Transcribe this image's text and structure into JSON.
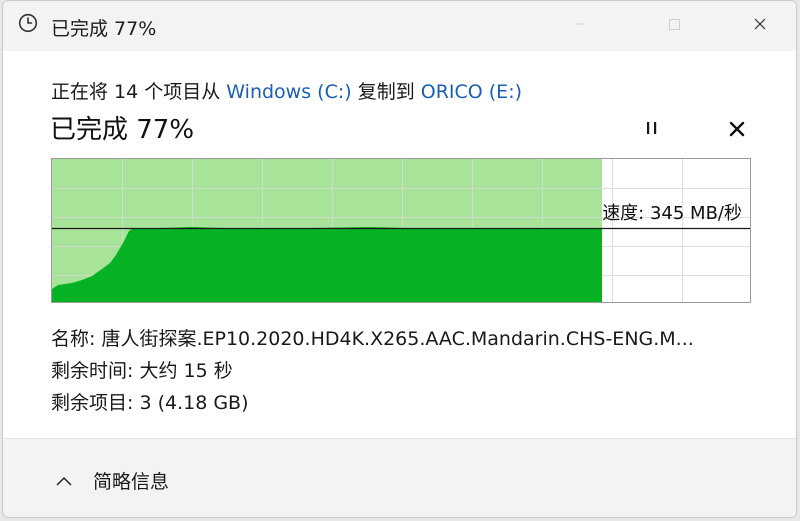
{
  "window": {
    "title": "已完成 77%"
  },
  "header": {
    "prefix": "正在将 14 个项目从 ",
    "source": "Windows (C:)",
    "middle": " 复制到 ",
    "destination": "ORICO (E:)"
  },
  "status": {
    "text": "已完成 77%",
    "progress_percent": 77
  },
  "graph": {
    "speed_label": "速度: 345 MB/秒",
    "colors": {
      "done_light": "#a8e39a",
      "done_dark": "#06b223",
      "grid": "#d9d9d9",
      "line": "#1a1a1a"
    }
  },
  "details": {
    "name_label": "名称:",
    "name_value": "唐人街探案.EP10.2020.HD4K.X265.AAC.Mandarin.CHS-ENG.M...",
    "time_label": "剩余时间:",
    "time_value": "大约 15 秒",
    "items_label": "剩余项目:",
    "items_value": "3 (4.18 GB)"
  },
  "footer": {
    "collapse_label": "简略信息"
  },
  "icons": {
    "title": "clock-icon",
    "pause": "pause-icon",
    "cancel": "close-icon",
    "collapse": "chevron-up-icon"
  }
}
